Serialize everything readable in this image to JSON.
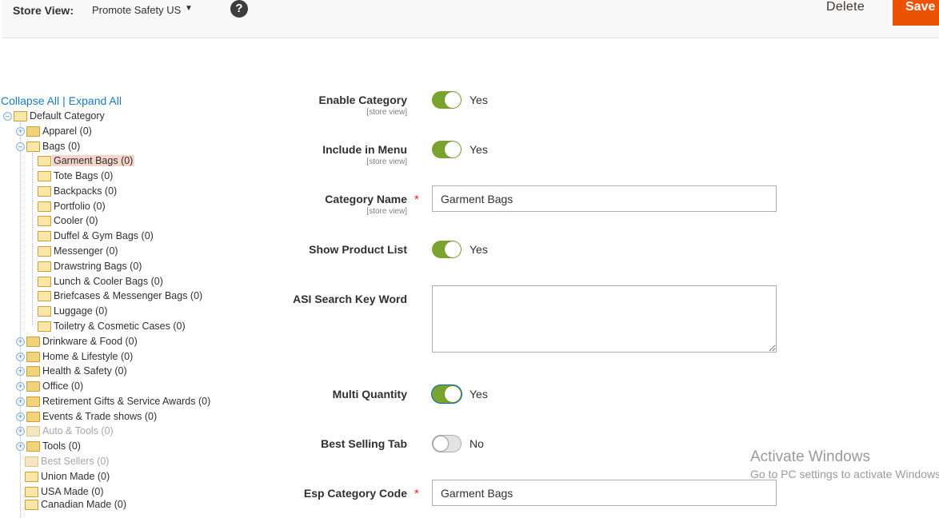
{
  "header": {
    "store_view_label": "Store View:",
    "store_view_value": "Promote Safety US",
    "help_glyph": "?",
    "delete_label": "Delete",
    "save_label": "Save",
    "save_color": "#eb5202"
  },
  "tree": {
    "collapse_all": "Collapse All",
    "separator": "|",
    "expand_all": "Expand All",
    "root": "Default Category",
    "top_a": [
      "Apparel (0)",
      "Bags (0)"
    ],
    "bags_children": [
      "Garment Bags (0)",
      "Tote Bags (0)",
      "Backpacks (0)",
      "Portfolio (0)",
      "Cooler (0)",
      "Duffel & Gym Bags (0)",
      "Messenger (0)",
      "Drawstring Bags (0)",
      "Lunch & Cooler Bags (0)",
      "Briefcases & Messenger Bags (0)",
      "Luggage (0)",
      "Toiletry & Cosmetic Cases (0)"
    ],
    "top_b": [
      "Drinkware & Food (0)",
      "Home & Lifestyle (0)",
      "Health & Safety (0)",
      "Office (0)",
      "Retirement Gifts & Service Awards (0)",
      "Events & Trade shows (0)",
      "Auto & Tools (0)",
      "Tools (0)",
      "Best Sellers (0)",
      "Union Made (0)",
      "USA Made (0)",
      "Canadian Made (0)"
    ],
    "selected_highlight": "#f6d6cb"
  },
  "form": {
    "enable_category": {
      "label": "Enable Category",
      "scope": "[store view]",
      "value": "Yes"
    },
    "include_in_menu": {
      "label": "Include in Menu",
      "scope": "[store view]",
      "value": "Yes"
    },
    "category_name": {
      "label": "Category Name",
      "scope": "[store view]",
      "value": "Garment Bags",
      "required": "*"
    },
    "show_product_list": {
      "label": "Show Product List",
      "value": "Yes"
    },
    "asi_search_key_word": {
      "label": "ASI Search Key Word",
      "value": ""
    },
    "multi_quantity": {
      "label": "Multi Quantity",
      "value": "Yes"
    },
    "best_selling_tab": {
      "label": "Best Selling Tab",
      "value": "No"
    },
    "esp_category_code": {
      "label": "Esp Category Code",
      "value": "Garment Bags",
      "required": "*"
    },
    "toggle_on_color": "#79a22e"
  },
  "watermark": {
    "title": "Activate Windows",
    "subtitle": "Go to PC settings to activate Windows."
  }
}
